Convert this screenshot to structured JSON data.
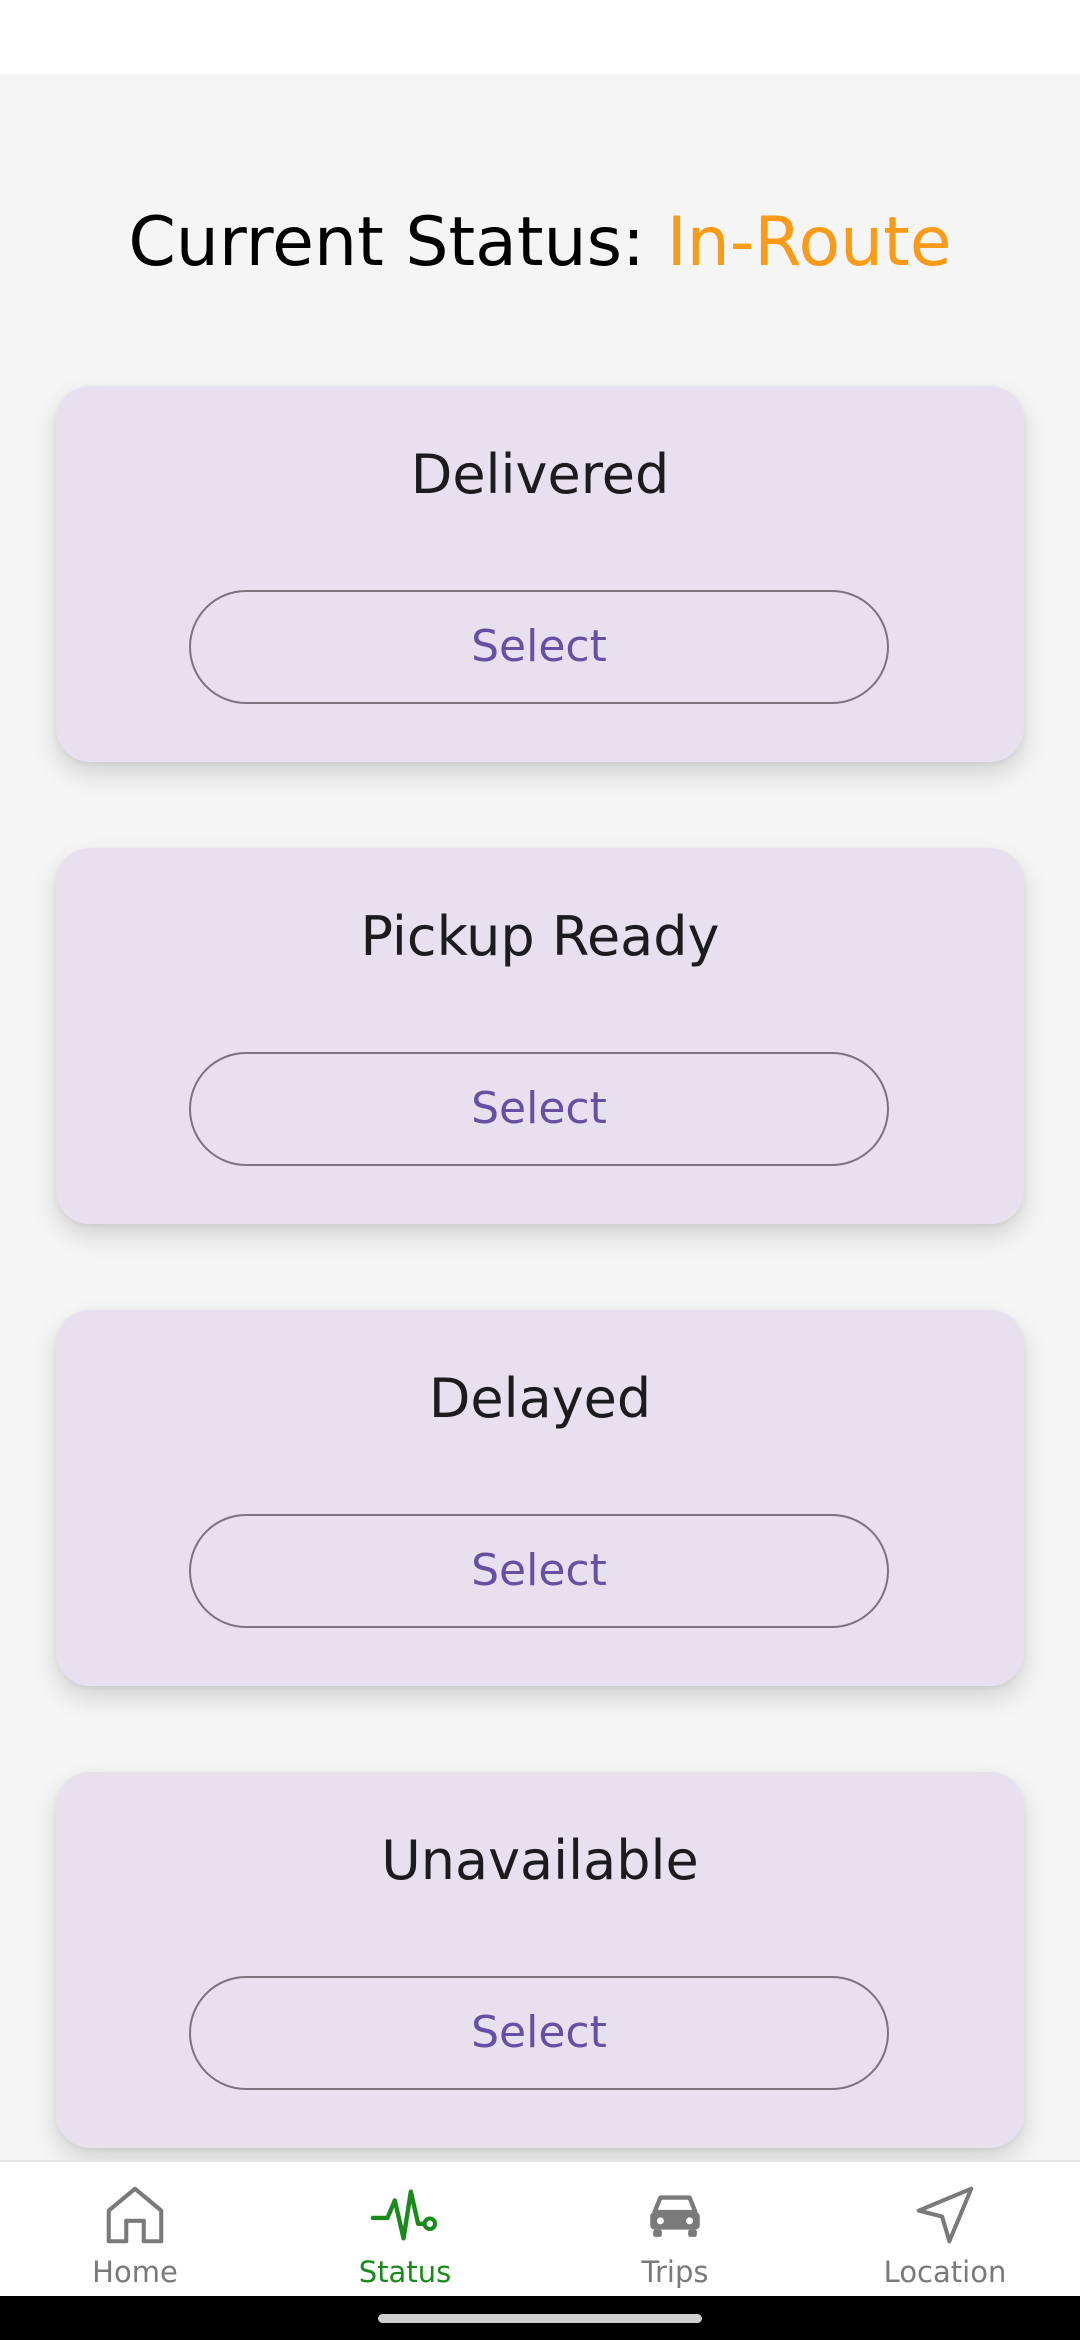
{
  "header": {
    "label": "Current Status:",
    "value": "In-Route",
    "value_color": "#f99b17"
  },
  "options": [
    {
      "title": "Delivered",
      "button_label": "Select"
    },
    {
      "title": "Pickup Ready",
      "button_label": "Select"
    },
    {
      "title": "Delayed",
      "button_label": "Select"
    },
    {
      "title": "Unavailable",
      "button_label": "Select"
    }
  ],
  "nav": {
    "items": [
      {
        "label": "Home",
        "icon": "home-icon",
        "active": false
      },
      {
        "label": "Status",
        "icon": "activity-icon",
        "active": true
      },
      {
        "label": "Trips",
        "icon": "car-icon",
        "active": false
      },
      {
        "label": "Location",
        "icon": "navigation-arrow-icon",
        "active": false
      }
    ],
    "active_color": "#1a8a1a",
    "inactive_color": "#7a7a7a"
  },
  "theme": {
    "card_color": "#e7e1ef",
    "button_text_color": "#6750a4"
  }
}
